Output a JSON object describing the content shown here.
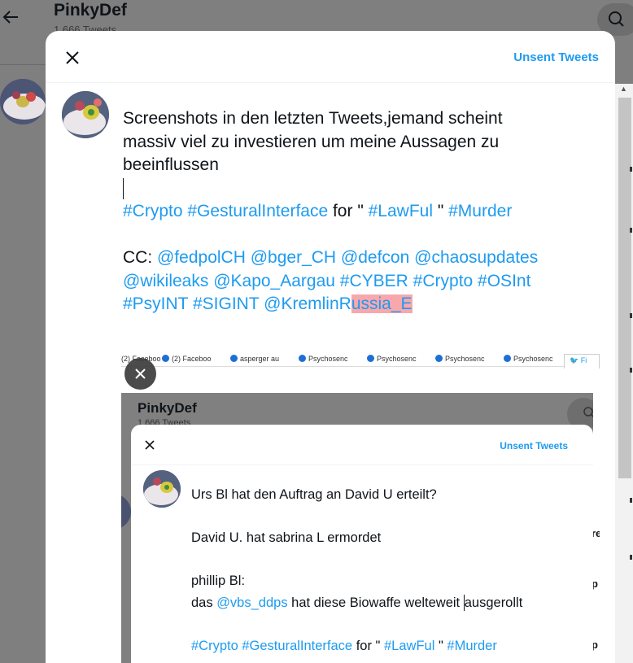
{
  "background": {
    "profile_name": "PinkyDef",
    "tweet_count": "1 666 Tweets"
  },
  "modal": {
    "unsent_label": "Unsent Tweets",
    "compose": {
      "line1": "Screenshots in den letzten Tweets,jemand scheint",
      "line2": "massiv viel zu investieren um meine Aussagen zu",
      "line3": "beeinflussen",
      "tags_line": {
        "t1": "#Crypto",
        "t2": "#GesturalInterface",
        "w1": " for \" ",
        "t3": "#LawFul",
        "w2": " \" ",
        "t4": "#Murder"
      },
      "cc_line1": {
        "cc": "CC: ",
        "m1": "@fedpolCH",
        "m2": "@bger_CH",
        "m3": "@defcon",
        "m4": "@chaosupdates"
      },
      "cc_line2": {
        "m1": "@wikileaks",
        "m2": "@Kapo_Aargau",
        "t1": "#CYBER",
        "t2": "#Crypto",
        "t3": "#OSInt"
      },
      "cc_line3": {
        "t1": "#PsyINT",
        "t2": "#SIGINT",
        "m1a": "@KremlinR",
        "m1b": "ussia_E "
      }
    },
    "media": {
      "tabs": [
        "(2) Faceboo",
        "asperger au",
        "Psychosenc",
        "Psychosenc",
        "Psychosenc",
        "Psychosenc"
      ],
      "active_tab": "Fi",
      "inner_profile_name": "PinkyDef",
      "inner_tweet_count": "1 666 Tweets",
      "inner_unsent_label": "Unsent Tweets",
      "inner_text": {
        "l1": "Urs Bl hat den Auftrag an David U erteilt?",
        "l2": "David U. hat sabrina L ermordet",
        "l3": "phillip Bl:",
        "l4a": "das ",
        "l4m": "@vbs_ddps",
        "l4b": " hat diese Biowaffe welteweit ",
        "l4c": "ausgerollt",
        "l5t1": "#Crypto",
        "l5t2": "#GesturalInterface",
        "l5w1": " for \" ",
        "l5t3": "#LawFul",
        "l5w2": " \" ",
        "l5t4": "#Murder"
      },
      "right_fragments": [
        "re",
        "p",
        "p"
      ]
    }
  },
  "colors": {
    "accent": "#1d9bf0",
    "highlight": "#f8a8ad",
    "overlay": "#7f7f7f"
  }
}
